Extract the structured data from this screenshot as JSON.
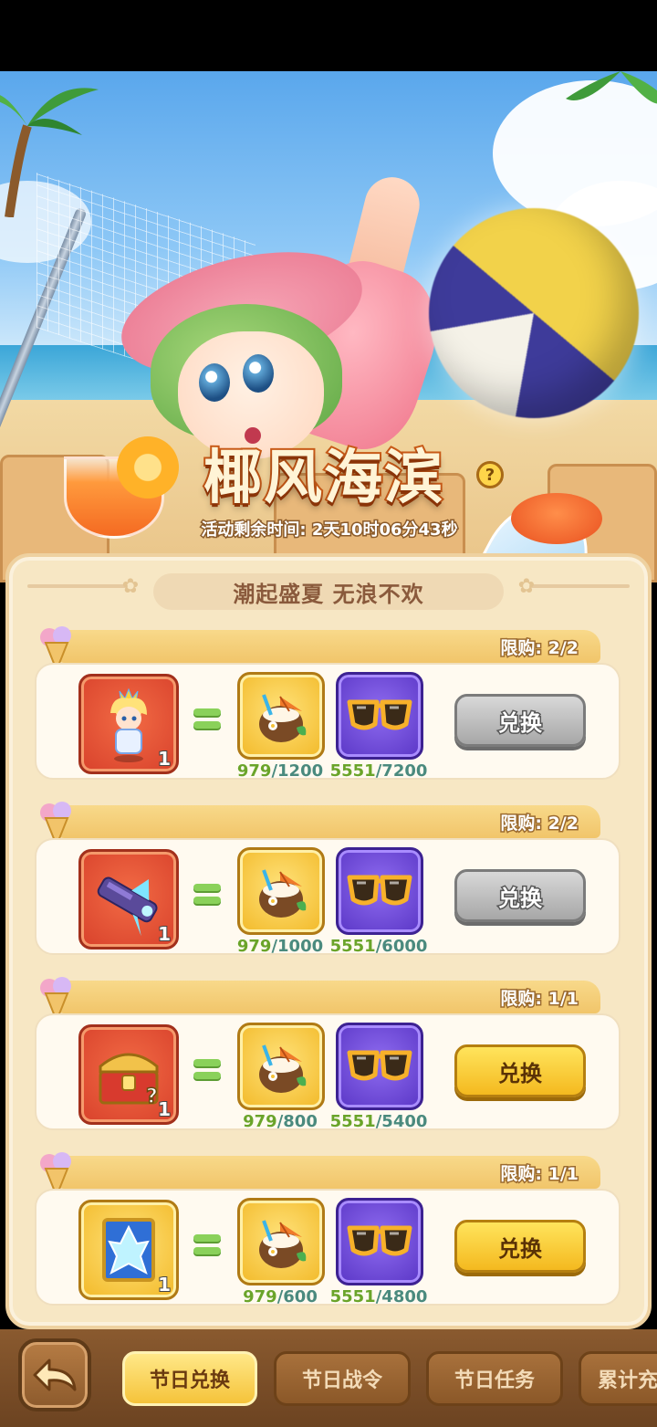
{
  "event": {
    "title": "椰风海滨",
    "timer_label": "活动剩余时间:",
    "timer_value": "2天10时06分43秒",
    "help_label": "?"
  },
  "panel": {
    "subtitle": "潮起盛夏 无浪不欢"
  },
  "cards": [
    {
      "limit": "限购: 2/2",
      "reward_icon": "prince-character-icon",
      "reward_qty": "1",
      "cost1_have": "979",
      "cost1_need": "/1200",
      "cost2_have": "5551",
      "cost2_need": "/7200",
      "button": "兑换",
      "button_state": "disabled"
    },
    {
      "limit": "限购: 2/2",
      "reward_icon": "ice-blaster-weapon-icon",
      "reward_qty": "1",
      "cost1_have": "979",
      "cost1_need": "/1000",
      "cost2_have": "5551",
      "cost2_need": "/6000",
      "button": "兑换",
      "button_state": "disabled"
    },
    {
      "limit": "限购: 1/1",
      "reward_icon": "mystery-treasure-chest-icon",
      "reward_qty": "1",
      "cost1_have": "979",
      "cost1_need": "/800",
      "cost2_have": "5551",
      "cost2_need": "/5400",
      "button": "兑换",
      "button_state": "enabled"
    },
    {
      "limit": "限购: 1/1",
      "reward_icon": "ice-crystal-card-icon",
      "reward_qty": "1",
      "cost1_have": "979",
      "cost1_need": "/600",
      "cost2_have": "5551",
      "cost2_need": "/4800",
      "button": "兑换",
      "button_state": "enabled"
    }
  ],
  "currencies": {
    "cost1_icon": "coconut-drink-icon",
    "cost2_icon": "sunglasses-icon"
  },
  "tabs": [
    {
      "label": "节日兑换",
      "active": true
    },
    {
      "label": "节日战令",
      "active": false
    },
    {
      "label": "节日任务",
      "active": false
    },
    {
      "label": "累计充",
      "active": false
    }
  ],
  "colors": {
    "have_green": "#6aa42a",
    "need_teal": "#4a8a7e",
    "button_yellow": "#f4b91f",
    "button_gray": "#a7a7a7",
    "tab_active": "#f5c33a"
  }
}
